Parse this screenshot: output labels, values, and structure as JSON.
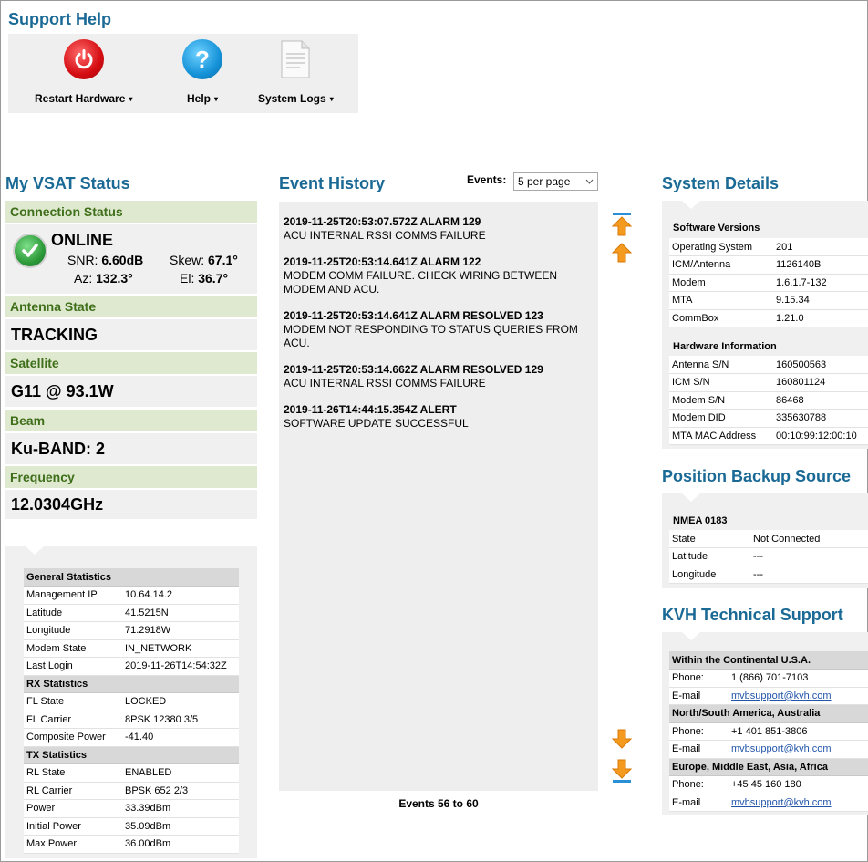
{
  "page": {
    "title": "Support Help"
  },
  "toolbar": {
    "restart_label": "Restart Hardware",
    "help_label": "Help",
    "logs_label": "System Logs",
    "caret": "▾"
  },
  "vsat": {
    "title": "My VSAT Status",
    "connection": {
      "label": "Connection Status",
      "state": "ONLINE",
      "snr_label": "SNR:",
      "snr": "6.60dB",
      "skew_label": "Skew:",
      "skew": "67.1°",
      "az_label": "Az:",
      "az": "132.3°",
      "el_label": "El:",
      "el": "36.7°"
    },
    "antenna": {
      "label": "Antenna State",
      "value": "TRACKING"
    },
    "satellite": {
      "label": "Satellite",
      "value": "G11 @ 93.1W"
    },
    "beam": {
      "label": "Beam",
      "value": "Ku-BAND: 2"
    },
    "frequency": {
      "label": "Frequency",
      "value": "12.0304GHz"
    }
  },
  "stats": {
    "general": {
      "header": "General Statistics",
      "rows": [
        [
          "Management IP",
          "10.64.14.2"
        ],
        [
          "Latitude",
          "41.5215N"
        ],
        [
          "Longitude",
          "71.2918W"
        ],
        [
          "Modem State",
          "IN_NETWORK"
        ],
        [
          "Last Login",
          "2019-11-26T14:54:32Z"
        ]
      ]
    },
    "rx": {
      "header": "RX Statistics",
      "rows": [
        [
          "FL State",
          "LOCKED"
        ],
        [
          "FL Carrier",
          "8PSK 12380 3/5"
        ],
        [
          "Composite Power",
          "-41.40"
        ]
      ]
    },
    "tx": {
      "header": "TX Statistics",
      "rows": [
        [
          "RL State",
          "ENABLED"
        ],
        [
          "RL Carrier",
          "BPSK 652 2/3"
        ],
        [
          "Power",
          "33.39dBm"
        ],
        [
          "Initial Power",
          "35.09dBm"
        ],
        [
          "Max Power",
          "36.00dBm"
        ]
      ]
    }
  },
  "events": {
    "title": "Event History",
    "per_page_label": "Events:",
    "per_page_value": "5 per page",
    "items": [
      {
        "time": "2019-11-25T20:53:07.572Z ALARM 129",
        "msg": "ACU INTERNAL RSSI COMMS FAILURE"
      },
      {
        "time": "2019-11-25T20:53:14.641Z ALARM 122",
        "msg": "MODEM COMM FAILURE. CHECK WIRING BETWEEN MODEM AND ACU."
      },
      {
        "time": "2019-11-25T20:53:14.641Z ALARM RESOLVED 123",
        "msg": "MODEM NOT RESPONDING TO STATUS QUERIES FROM ACU."
      },
      {
        "time": "2019-11-25T20:53:14.662Z ALARM RESOLVED 129",
        "msg": "ACU INTERNAL RSSI COMMS FAILURE"
      },
      {
        "time": "2019-11-26T14:44:15.354Z ALERT",
        "msg": "SOFTWARE UPDATE SUCCESSFUL"
      }
    ],
    "range": "Events 56 to 60"
  },
  "system": {
    "title": "System Details",
    "software": {
      "header": "Software Versions",
      "rows": [
        [
          "Operating System",
          "201"
        ],
        [
          "ICM/Antenna",
          "1126140B"
        ],
        [
          "Modem",
          "1.6.1.7-132"
        ],
        [
          "MTA",
          "9.15.34"
        ],
        [
          "CommBox",
          "1.21.0"
        ]
      ]
    },
    "hardware": {
      "header": "Hardware Information",
      "rows": [
        [
          "Antenna S/N",
          "160500563"
        ],
        [
          "ICM S/N",
          "160801124"
        ],
        [
          "Modem S/N",
          "86468"
        ],
        [
          "Modem DID",
          "335630788"
        ],
        [
          "MTA MAC Address",
          "00:10:99:12:00:10"
        ]
      ]
    }
  },
  "position": {
    "title": "Position Backup Source",
    "header": "NMEA 0183",
    "rows": [
      [
        "State",
        "Not Connected"
      ],
      [
        "Latitude",
        "---"
      ],
      [
        "Longitude",
        "---"
      ]
    ]
  },
  "support": {
    "title": "KVH Technical Support",
    "regions": [
      {
        "name": "Within the Continental U.S.A.",
        "phone_label": "Phone:",
        "phone": "1 (866) 701-7103",
        "email_label": "E-mail",
        "email": "mvbsupport@kvh.com"
      },
      {
        "name": "North/South America, Australia",
        "phone_label": "Phone:",
        "phone": "+1 401 851-3806",
        "email_label": "E-mail",
        "email": "mvbsupport@kvh.com"
      },
      {
        "name": "Europe, Middle East, Asia, Africa",
        "phone_label": "Phone:",
        "phone": "+45 45 160 180",
        "email_label": "E-mail",
        "email": "mvbsupport@kvh.com"
      }
    ]
  },
  "colors": {
    "accent": "#1b6a96",
    "section_bg": "#dfe9cf",
    "section_text": "#3f6f1a",
    "arrow": "#f39a1f"
  }
}
